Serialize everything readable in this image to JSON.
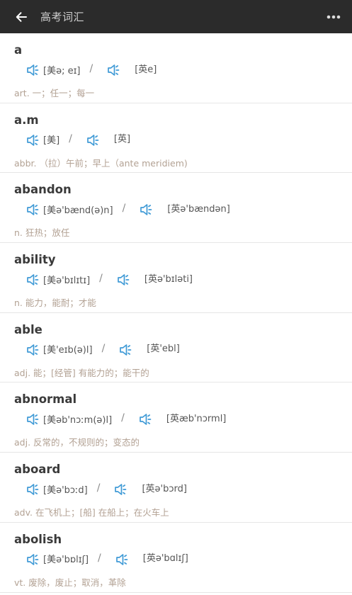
{
  "header": {
    "title": "高考词汇",
    "back_icon": "arrow-left-icon",
    "more_icon": "more-horizontal-icon"
  },
  "colors": {
    "header_bg": "#2b2b2b",
    "speaker": "#3f9ad6",
    "definition": "#b3a294",
    "word": "#3a3a3a"
  },
  "words": [
    {
      "word": "a",
      "us": "[美ə; eɪ]",
      "sep": "/",
      "uk": "[英e]",
      "definition": "art. 一；任一；每一"
    },
    {
      "word": "a.m",
      "us": "[美]",
      "sep": "/",
      "uk": "[英]",
      "definition": "abbr. （拉）午前；早上（ante meridiem)"
    },
    {
      "word": "abandon",
      "us": "[美ə'bænd(ə)n]",
      "sep": "/",
      "uk": "[英ə'bændən]",
      "definition": "n. 狂热；放任"
    },
    {
      "word": "ability",
      "us": "[美ə'bɪlɪtɪ]",
      "sep": "/",
      "uk": "[英ə'bɪləti]",
      "definition": "n. 能力，能耐；才能"
    },
    {
      "word": "able",
      "us": "[美'eɪb(ə)l]",
      "sep": "/",
      "uk": "[英'ebl]",
      "definition": "adj. 能；[经管] 有能力的；能干的"
    },
    {
      "word": "abnormal",
      "us": "[美əb'nɔːm(ə)l]",
      "sep": "/",
      "uk": "[英æb'nɔrml]",
      "definition": "adj. 反常的，不规则的；变态的"
    },
    {
      "word": "aboard",
      "us": "[美ə'bɔːd]",
      "sep": "/",
      "uk": "[英ə'bɔrd]",
      "definition": "adv. 在飞机上；[船] 在船上；在火车上"
    },
    {
      "word": "abolish",
      "us": "[美ə'bɒlɪʃ]",
      "sep": "/",
      "uk": "[英ə'bɑlɪʃ]",
      "definition": "vt. 废除，废止；取消，革除"
    }
  ]
}
